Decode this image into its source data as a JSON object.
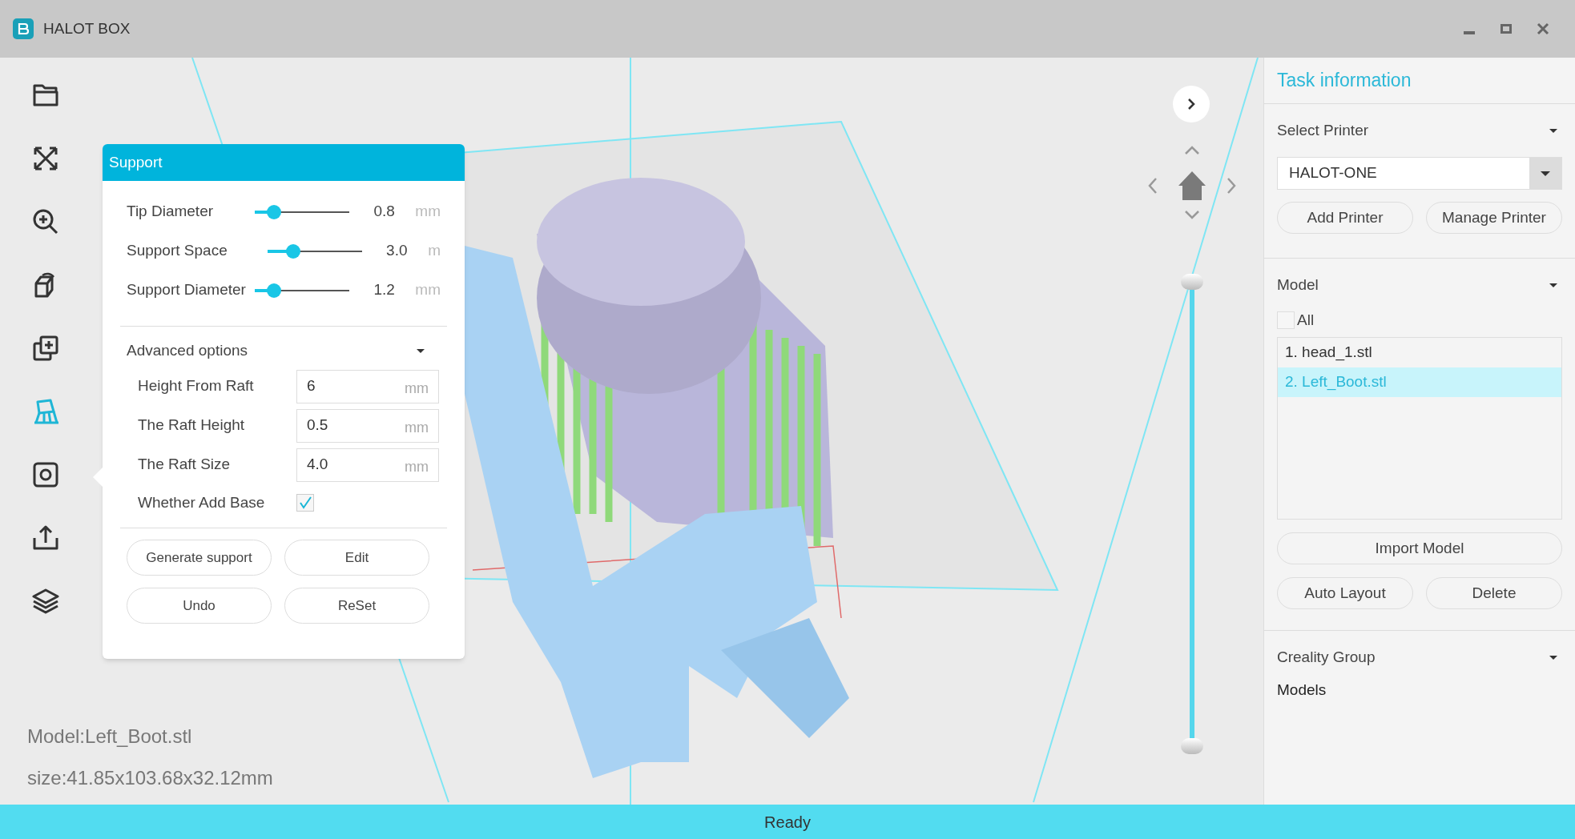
{
  "window": {
    "title": "HALOT BOX"
  },
  "toolbar": [
    {
      "kind": "open",
      "selected": false
    },
    {
      "kind": "fit",
      "selected": false
    },
    {
      "kind": "zoom",
      "selected": false
    },
    {
      "kind": "rotate",
      "selected": false
    },
    {
      "kind": "duplicate",
      "selected": false
    },
    {
      "kind": "support",
      "selected": true
    },
    {
      "kind": "hollow",
      "selected": false
    },
    {
      "kind": "export",
      "selected": false
    },
    {
      "kind": "layers",
      "selected": false
    }
  ],
  "support_panel": {
    "title": "Support",
    "sliders": [
      {
        "label": "Tip Diameter",
        "level": 0.2,
        "value": "0.8",
        "unit": "mm"
      },
      {
        "label": "Support Space",
        "level": 0.27,
        "value": "3.0",
        "unit": "m"
      },
      {
        "label": "Support Diameter",
        "level": 0.2,
        "value": "1.2",
        "unit": "mm"
      }
    ],
    "advanced": {
      "label": "Advanced options",
      "fields": [
        {
          "label": "Height From Raft",
          "value": "6",
          "unit": "mm"
        },
        {
          "label": "The Raft Height",
          "value": "0.5",
          "unit": "mm"
        },
        {
          "label": "The Raft Size",
          "value": "4.0",
          "unit": "mm"
        }
      ],
      "base": {
        "label": "Whether Add Base",
        "checked": true
      }
    },
    "buttons": [
      "Generate support",
      "Edit",
      "Undo",
      "ReSet"
    ]
  },
  "layer_slider": {
    "level": 1
  },
  "model_info": [
    "Model:Left_Boot.stl",
    "size:41.85x103.68x32.12mm"
  ],
  "task_panel": {
    "title": "Task information",
    "printer": {
      "heading": "Select Printer",
      "value": "HALOT-ONE",
      "buttons": [
        "Add Printer",
        "Manage Printer"
      ]
    },
    "model": {
      "heading": "Model",
      "all": {
        "label": "All",
        "checked": false
      },
      "files": [
        {
          "label": "1. head_1.stl",
          "selected": false
        },
        {
          "label": "2. Left_Boot.stl",
          "selected": true
        }
      ],
      "buttons": [
        "Import Model",
        "Auto Layout",
        "Delete"
      ]
    },
    "group": {
      "heading": "Creality Group",
      "label": "Models"
    }
  },
  "status_bar": "Ready"
}
